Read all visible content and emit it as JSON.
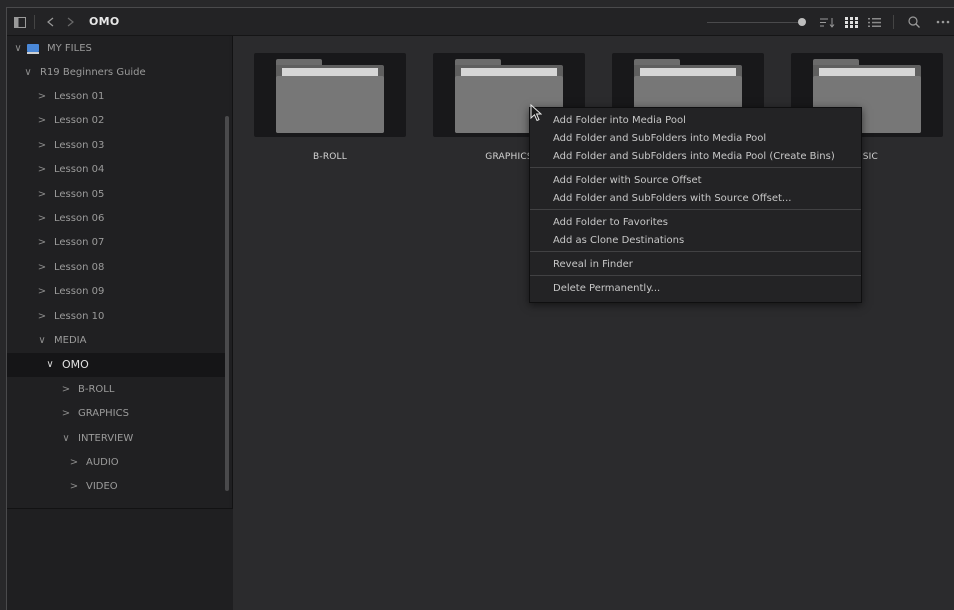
{
  "toolbar": {
    "path_title": "OMO",
    "zoom_level": 0.97,
    "icons": [
      "sidebar-toggle-icon",
      "back-icon",
      "forward-icon",
      "sort-icon",
      "grid-view-icon",
      "list-view-icon",
      "search-icon",
      "more-icon"
    ]
  },
  "sidebar": {
    "root_label": "MY FILES",
    "items": [
      {
        "label": "R19 Beginners Guide",
        "chevron": "v"
      },
      {
        "label": "Lesson 01",
        "chevron": ">"
      },
      {
        "label": "Lesson 02",
        "chevron": ">"
      },
      {
        "label": "Lesson 03",
        "chevron": ">"
      },
      {
        "label": "Lesson 04",
        "chevron": ">"
      },
      {
        "label": "Lesson 05",
        "chevron": ">"
      },
      {
        "label": "Lesson 06",
        "chevron": ">"
      },
      {
        "label": "Lesson 07",
        "chevron": ">"
      },
      {
        "label": "Lesson 08",
        "chevron": ">"
      },
      {
        "label": "Lesson 09",
        "chevron": ">"
      },
      {
        "label": "Lesson 10",
        "chevron": ">"
      },
      {
        "label": "MEDIA",
        "chevron": "v"
      },
      {
        "label": "OMO",
        "chevron": "v"
      },
      {
        "label": "B-ROLL",
        "chevron": ">"
      },
      {
        "label": "GRAPHICS",
        "chevron": ">"
      },
      {
        "label": "INTERVIEW",
        "chevron": "v"
      },
      {
        "label": "AUDIO",
        "chevron": ">"
      },
      {
        "label": "VIDEO",
        "chevron": ">"
      }
    ]
  },
  "main": {
    "folders": [
      {
        "label": "B-ROLL"
      },
      {
        "label": "GRAPHICS"
      },
      {
        "label": ""
      },
      {
        "label": "USIC"
      }
    ]
  },
  "context_menu": {
    "items": [
      {
        "label": "Add Folder into Media Pool"
      },
      {
        "label": "Add Folder and SubFolders into Media Pool"
      },
      {
        "label": "Add Folder and SubFolders into Media Pool (Create Bins)"
      },
      {
        "label": "Add Folder with Source Offset"
      },
      {
        "label": "Add Folder and SubFolders with Source Offset..."
      },
      {
        "label": "Add Folder to Favorites"
      },
      {
        "label": "Add as Clone Destinations"
      },
      {
        "label": "Reveal in Finder"
      },
      {
        "label": "Delete Permanently..."
      }
    ]
  },
  "colors": {
    "drive_icon": "#4a88d8",
    "selected_row": "#151517",
    "panel_bg": "#2b2b2d"
  }
}
